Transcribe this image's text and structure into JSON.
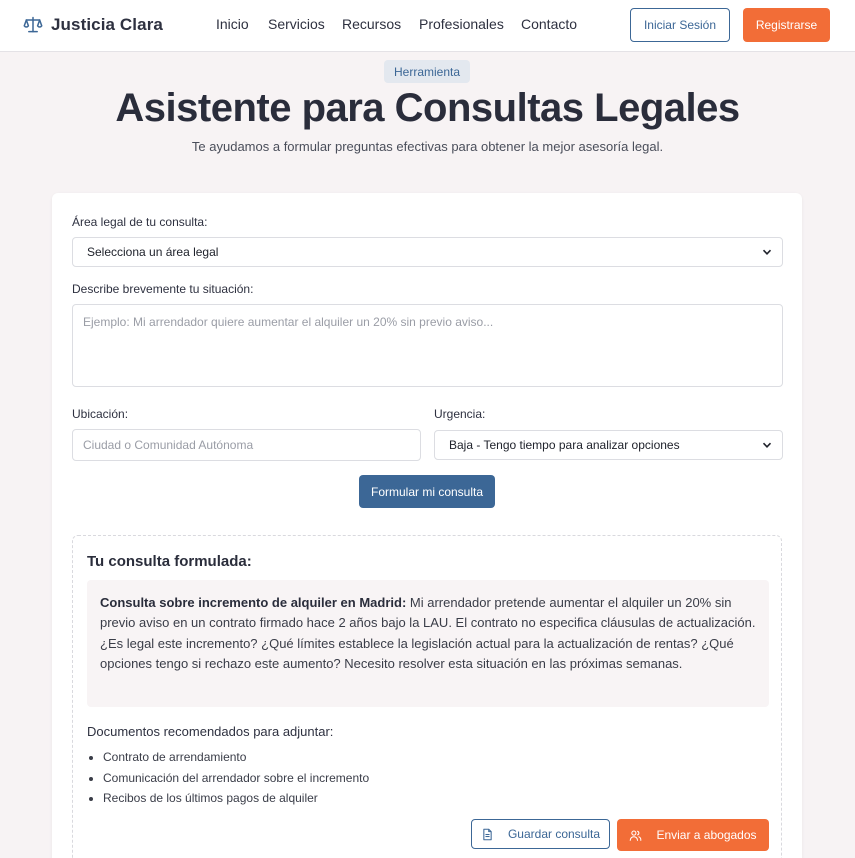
{
  "header": {
    "brand": "Justicia Clara",
    "nav": [
      "Inicio",
      "Servicios",
      "Recursos",
      "Profesionales",
      "Contacto"
    ],
    "login_label": "Iniciar Sesión",
    "register_label": "Registrarse"
  },
  "hero": {
    "badge": "Herramienta",
    "title": "Asistente para Consultas Legales",
    "subtitle": "Te ayudamos a formular preguntas efectivas para obtener la mejor asesoría legal."
  },
  "form": {
    "area_label": "Área legal de tu consulta:",
    "area_selected": "Selecciona un área legal",
    "situation_label": "Describe brevemente tu situación:",
    "situation_placeholder": "Ejemplo: Mi arrendador quiere aumentar el alquiler un 20% sin previo aviso...",
    "location_label": "Ubicación:",
    "location_placeholder": "Ciudad o Comunidad Autónoma",
    "urgency_label": "Urgencia:",
    "urgency_selected": "Baja - Tengo tiempo para analizar opciones",
    "submit_label": "Formular mi consulta"
  },
  "result": {
    "title": "Tu consulta formulada:",
    "query_heading": "Consulta sobre incremento de alquiler en Madrid:",
    "query_body": " Mi arrendador pretende aumentar el alquiler un 20% sin previo aviso en un contrato firmado hace 2 años bajo la LAU. El contrato no especifica cláusulas de actualización. ¿Es legal este incremento? ¿Qué límites establece la legislación actual para la actualización de rentas? ¿Qué opciones tengo si rechazo este aumento? Necesito resolver esta situación en las próximas semanas.",
    "docs_title": "Documentos recomendados para adjuntar:",
    "docs": [
      "Contrato de arrendamiento",
      "Comunicación del arrendador sobre el incremento",
      "Recibos de los últimos pagos de alquiler"
    ],
    "save_label": "Guardar consulta",
    "send_label": "Enviar a abogados"
  },
  "colors": {
    "primary": "#3c6796",
    "accent": "#f26d37",
    "background": "#f7f3f4"
  },
  "icons": {
    "logo": "scales-icon",
    "save": "document-icon",
    "send": "users-icon",
    "select": "chevron-down-icon"
  }
}
